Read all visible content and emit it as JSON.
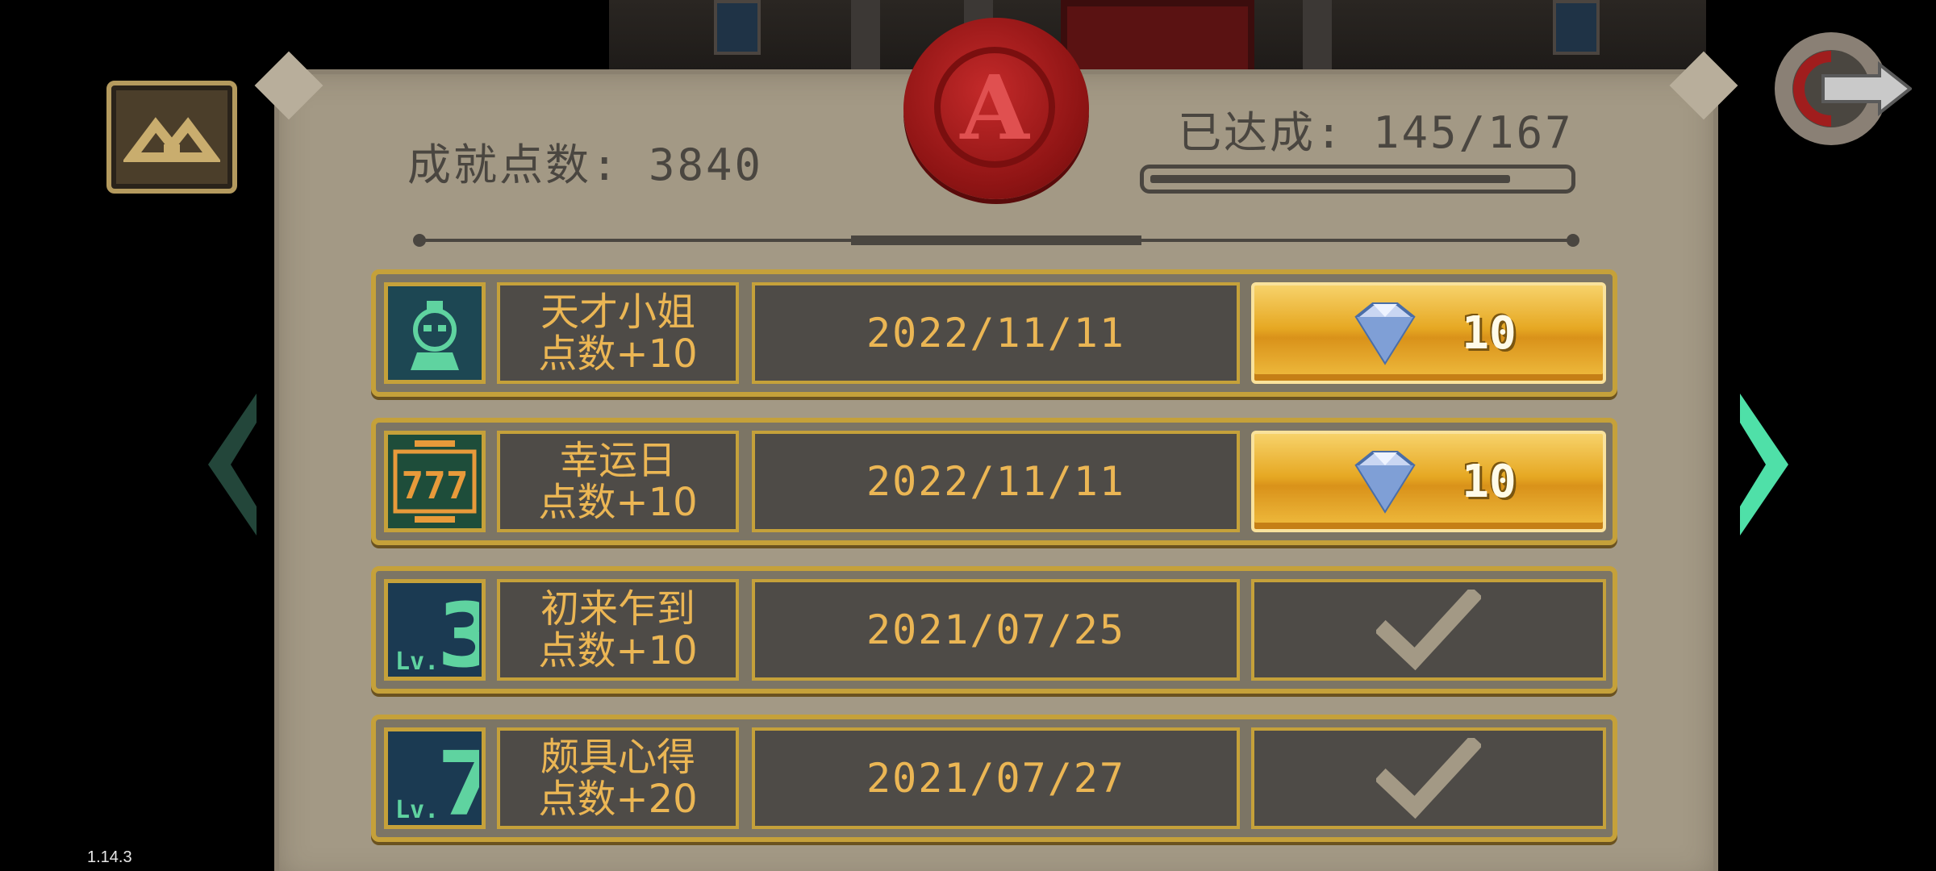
{
  "header": {
    "points_label": "成就点数: 3840",
    "achieved_label": "已达成: 145/167",
    "achieved_count": 145,
    "achieved_total": 167
  },
  "achievements": [
    {
      "title": "天才小姐",
      "points": "点数+10",
      "date": "2022/11/11",
      "reward_state": "claimable",
      "reward_amount": "10",
      "icon": "genius-lady-icon"
    },
    {
      "title": "幸运日",
      "points": "点数+10",
      "date": "2022/11/11",
      "reward_state": "claimable",
      "reward_amount": "10",
      "icon": "slot-777-icon"
    },
    {
      "title": "初来乍到",
      "points": "点数+10",
      "date": "2021/07/25",
      "reward_state": "claimed",
      "reward_amount": "",
      "icon": "level-3-icon",
      "icon_text": "3"
    },
    {
      "title": "颇具心得",
      "points": "点数+20",
      "date": "2021/07/27",
      "reward_state": "claimed",
      "reward_amount": "",
      "icon": "level-7-icon",
      "icon_text": "7"
    }
  ],
  "version": "1.14.3",
  "colors": {
    "parchment": "#a39985",
    "gold_border": "#c5a13a",
    "row_text": "#ebb654",
    "cell_bg": "#4e4b47",
    "seal_red": "#c42a2a",
    "icon_teal": "#5fd3a0"
  }
}
